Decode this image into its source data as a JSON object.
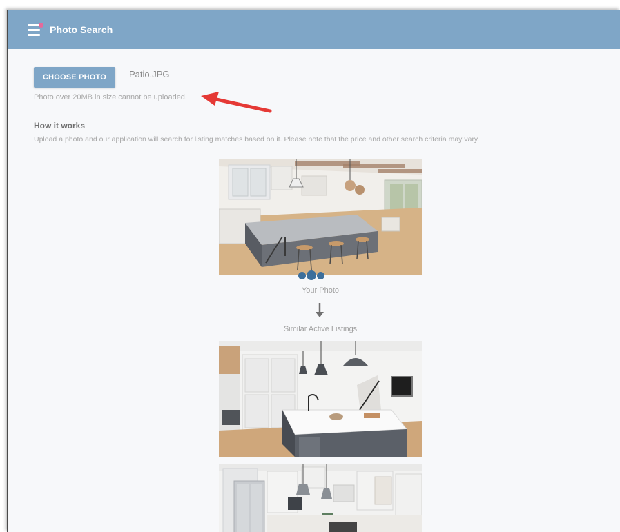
{
  "header": {
    "title": "Photo Search",
    "menu_icon": "menu-icon",
    "notification_color": "#e56a9b",
    "bar_color": "#7fa6c7"
  },
  "upload": {
    "choose_label": "CHOOSE PHOTO",
    "file_value": "Patio.JPG",
    "size_note": "Photo over 20MB in size cannot be uploaded.",
    "annotation_color": "#e53935"
  },
  "how_it_works": {
    "title": "How it works",
    "description": "Upload a photo and our application will search for listing matches based on it. Please note that the price and other search criteria may vary."
  },
  "illustration": {
    "your_photo_label": "Your Photo",
    "arrow_icon": "arrow-down-icon",
    "similar_label": "Similar Active Listings",
    "dot_color": "#3c6f9c"
  }
}
